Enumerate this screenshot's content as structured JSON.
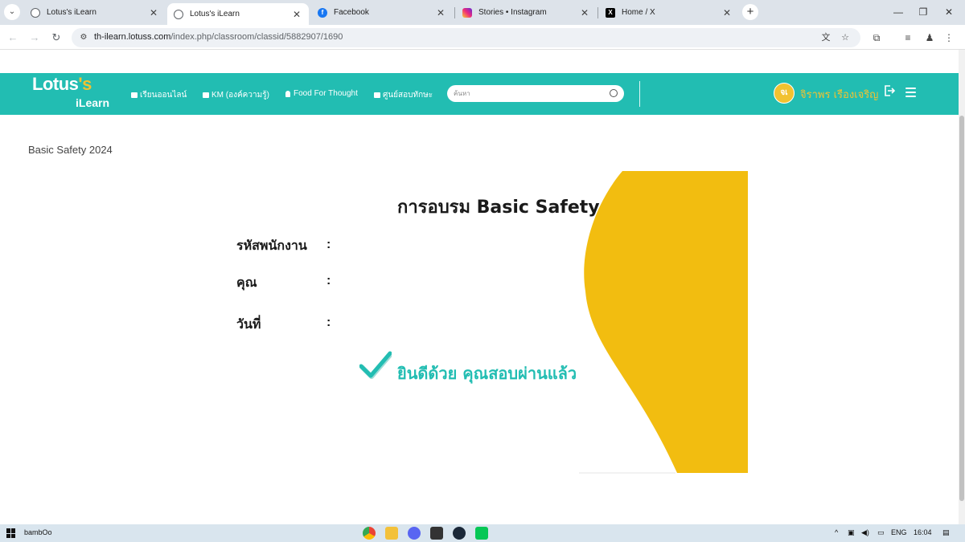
{
  "browser": {
    "tabs": [
      {
        "title": "Lotus's iLearn",
        "favicon": "globe-icon",
        "active": false
      },
      {
        "title": "Lotus's iLearn",
        "favicon": "globe-icon",
        "active": true
      },
      {
        "title": "Facebook",
        "favicon": "facebook-icon",
        "active": false
      },
      {
        "title": "Stories • Instagram",
        "favicon": "instagram-icon",
        "active": false
      },
      {
        "title": "Home / X",
        "favicon": "x-icon",
        "active": false
      }
    ],
    "url_host": "th-ilearn.lotuss.com",
    "url_path": "/index.php/classroom/classid/5882907/1690"
  },
  "site": {
    "logo_main": "Lotus",
    "logo_mark": "'s",
    "logo_sub": "iLearn",
    "brand_color": "#22bdb2",
    "accent_color": "#f2c230",
    "menu": [
      {
        "label": "เรียนออนไลน์",
        "icon": "book-icon"
      },
      {
        "label": "KM (องค์ความรู้)",
        "icon": "book-icon"
      },
      {
        "label": "Food For Thought",
        "icon": "lightbulb-icon"
      },
      {
        "label": "ศูนย์สอบทักษะ",
        "icon": "folder-icon"
      }
    ],
    "search_placeholder": "ค้นหา",
    "user": {
      "initials": "จเ",
      "name": "จิราพร เรืองเจริญ"
    }
  },
  "breadcrumb": "Basic Safety 2024",
  "certificate": {
    "title": "การอบรม Basic Safety",
    "fields": [
      {
        "label": "รหัสพนักงาน",
        "colon": ":",
        "value": ""
      },
      {
        "label": "คุณ",
        "colon": ":",
        "value": ""
      },
      {
        "label": "วันที่",
        "colon": ":",
        "value": ""
      }
    ],
    "success_message": "ยินดีด้วย คุณสอบผ่านแล้ว"
  },
  "taskbar": {
    "user_label": "bambOo",
    "language": "ENG",
    "clock": "16:04"
  }
}
